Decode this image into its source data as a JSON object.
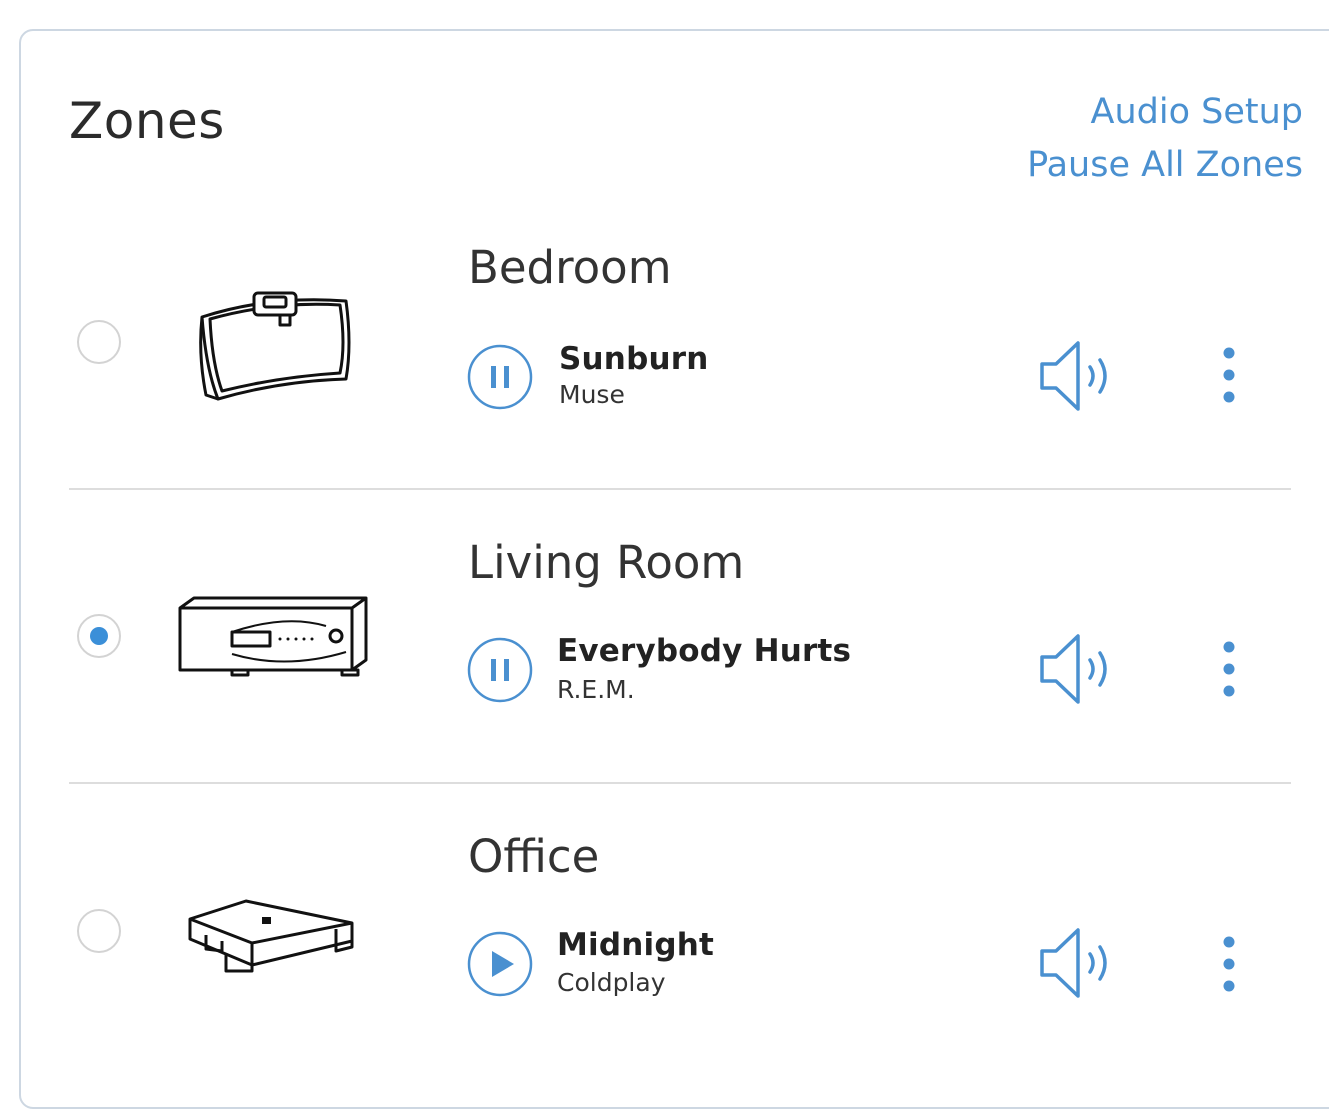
{
  "header": {
    "title": "Zones",
    "audio_setup": "Audio Setup",
    "pause_all": "Pause All Zones"
  },
  "zones": [
    {
      "name": "Bedroom",
      "track": "Sunburn",
      "artist": "Muse",
      "state": "playing",
      "selected": false,
      "device_icon": "wireless-speaker-icon"
    },
    {
      "name": "Living Room",
      "track": "Everybody Hurts",
      "artist": "R.E.M.",
      "state": "playing",
      "selected": true,
      "device_icon": "av-receiver-icon"
    },
    {
      "name": "Office",
      "track": "Midnight",
      "artist": "Coldplay",
      "state": "paused",
      "selected": false,
      "device_icon": "streaming-box-icon"
    }
  ],
  "colors": {
    "accent": "#4a90d0",
    "divider": "#dddddd",
    "radio_on": "#3b8fd8"
  }
}
